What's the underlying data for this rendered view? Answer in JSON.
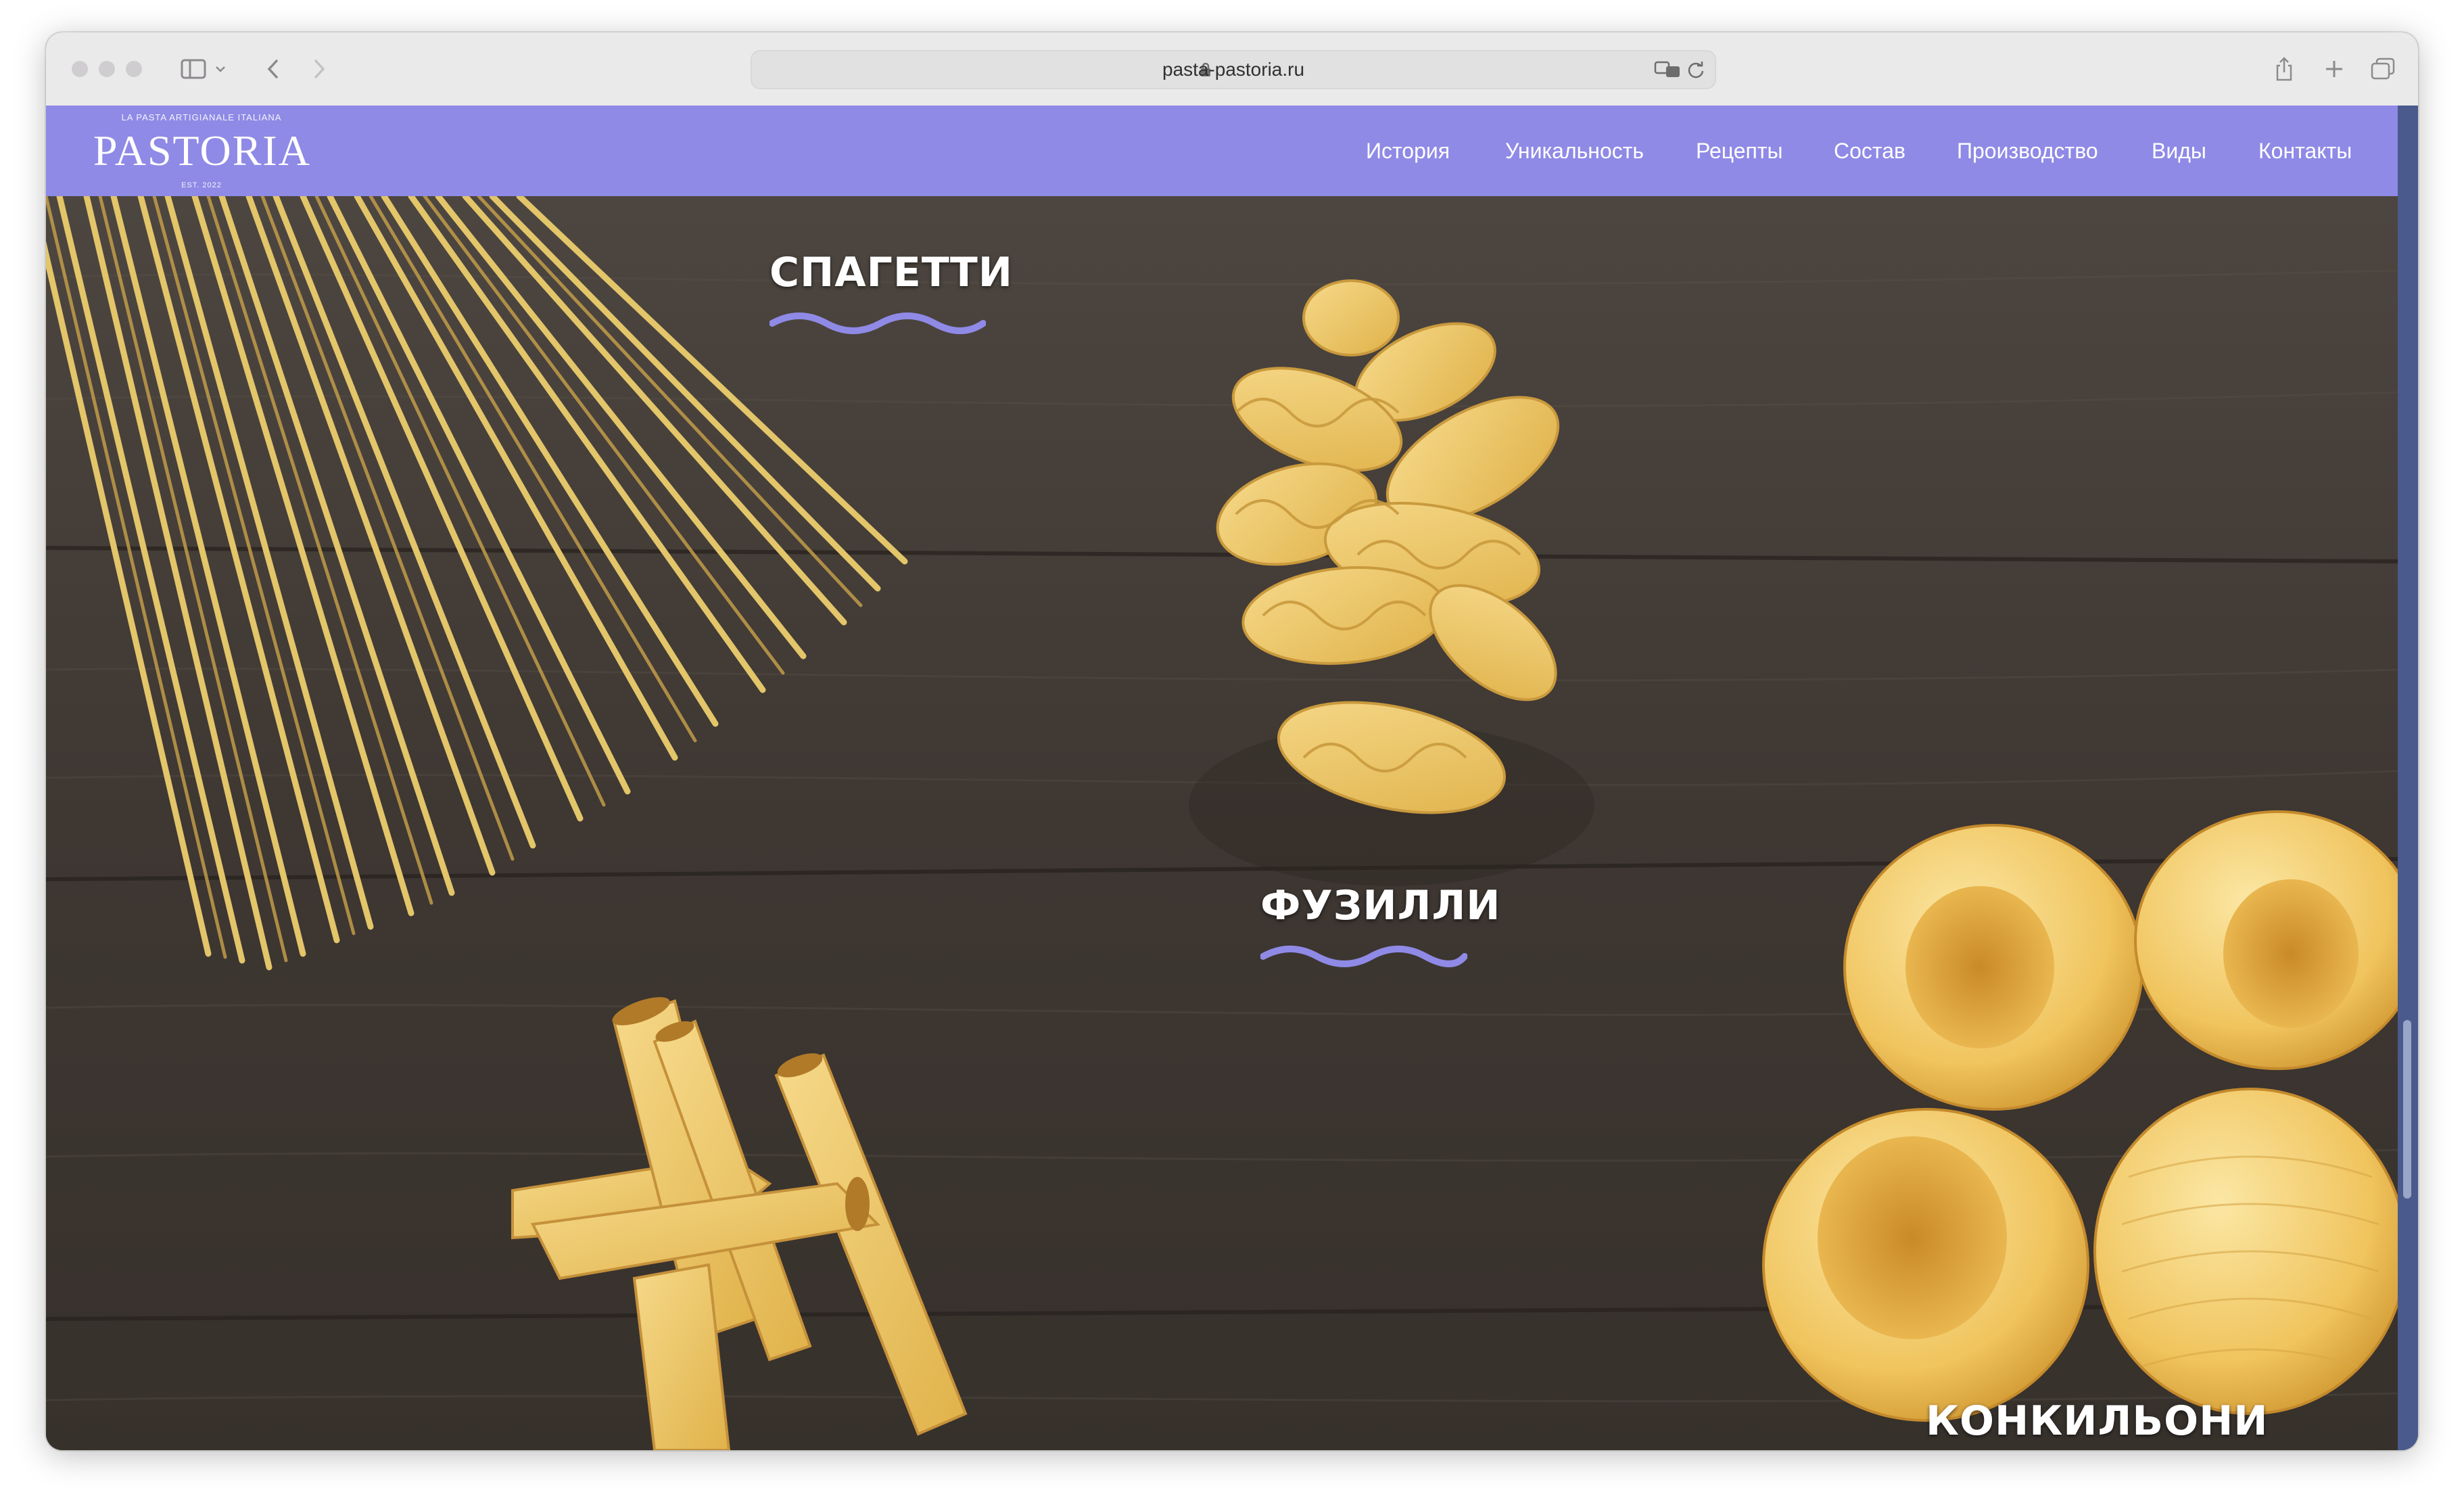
{
  "browser": {
    "url": "pasta-pastoria.ru"
  },
  "site": {
    "logo": {
      "tagline": "LA PASTA ARTIGIANALE ITALIANA",
      "name": "PASTORIA",
      "est": "EST. 2022"
    },
    "nav": [
      "История",
      "Уникальность",
      "Рецепты",
      "Состав",
      "Производство",
      "Виды",
      "Контакты"
    ]
  },
  "hero": {
    "labels": {
      "spaghetti": "СПАГЕТТИ",
      "fusilli": "ФУЗИЛЛИ",
      "conchiglioni": "КОНКИЛЬОНИ"
    },
    "accent_color": "#8f8ae6"
  }
}
